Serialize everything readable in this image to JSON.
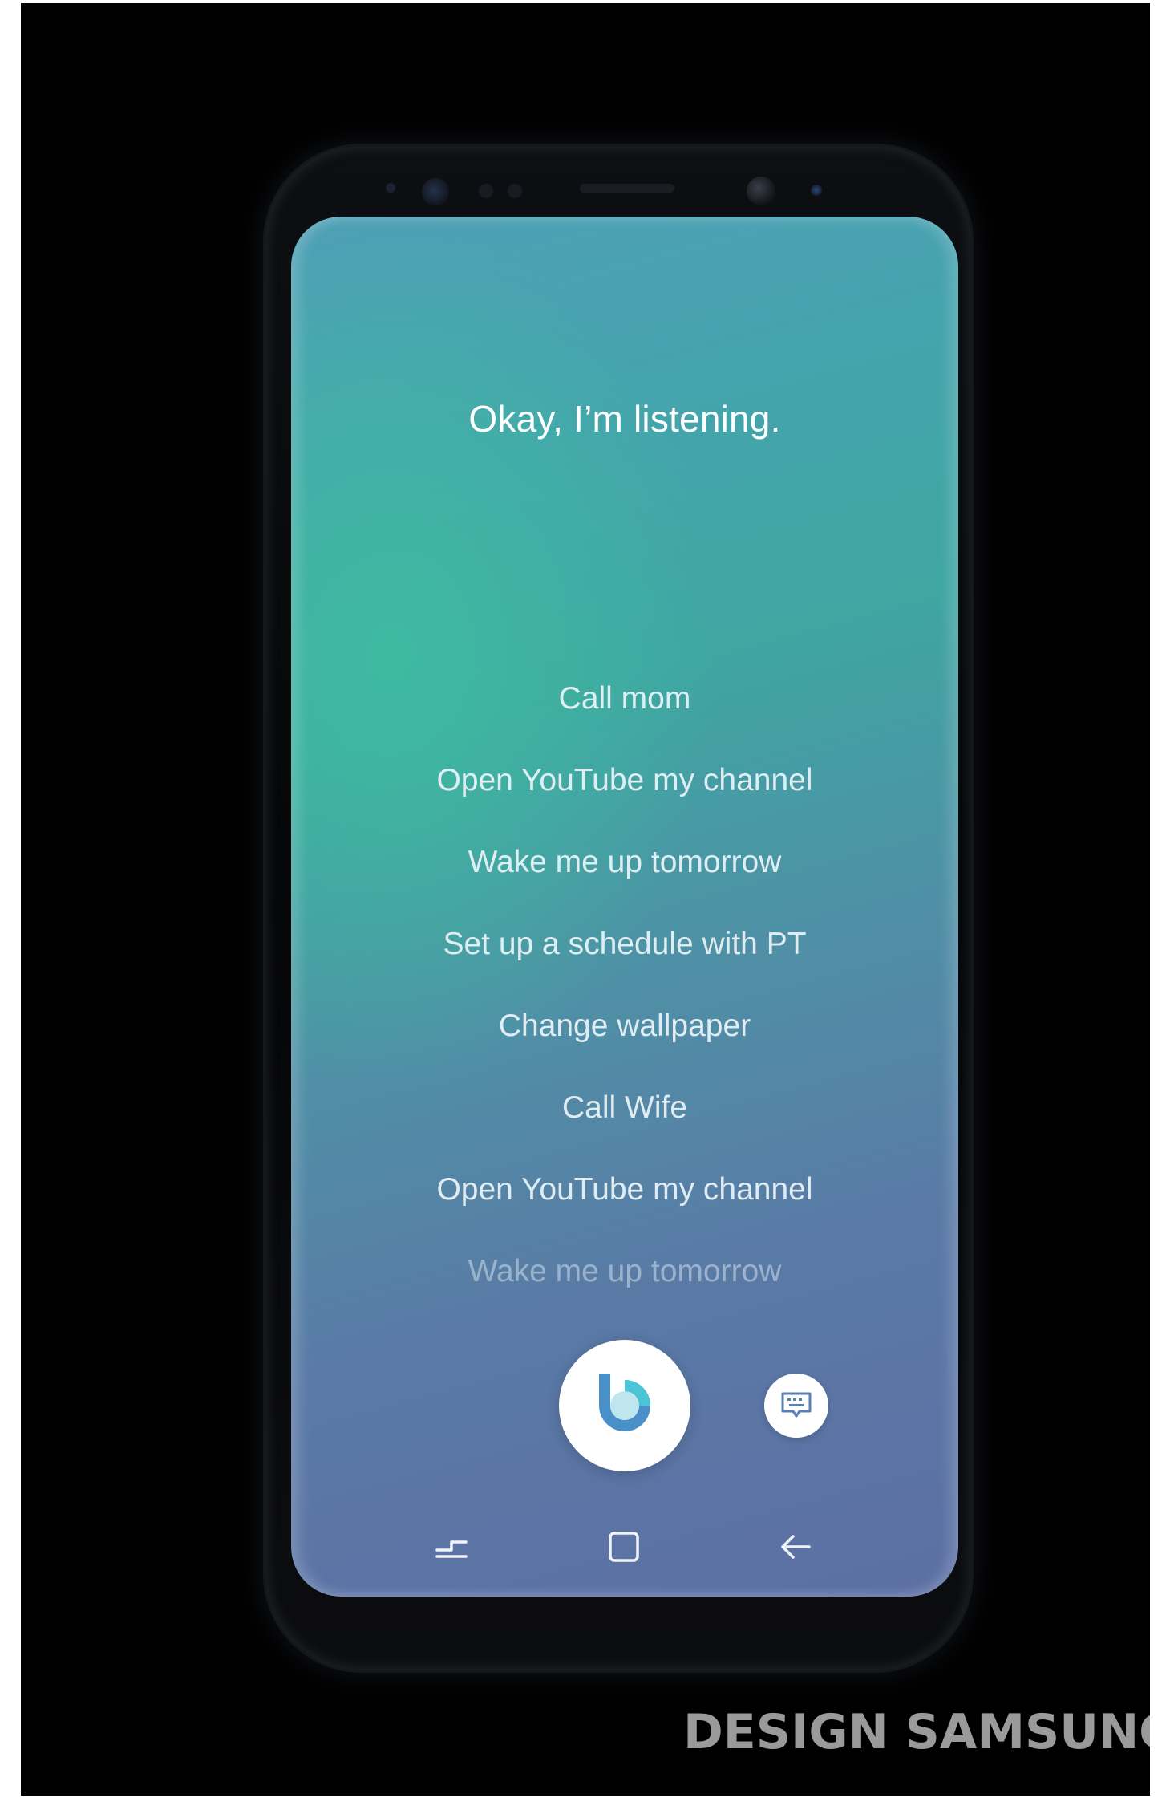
{
  "screen": {
    "title": "Okay, I’m listening.",
    "suggestions": [
      "Call mom",
      "Open YouTube my channel",
      "Wake me up tomorrow",
      "Set up a schedule with PT",
      "Change wallpaper",
      "Call Wife",
      "Open YouTube my channel",
      "Wake me up tomorrow"
    ]
  },
  "controls": {
    "voice_button_icon": "bixby-logo-icon",
    "keyboard_button_icon": "keyboard-icon"
  },
  "nav": {
    "recent_icon": "recent-apps-icon",
    "home_icon": "home-icon",
    "back_icon": "back-arrow-icon"
  },
  "watermark": "DESIGN SAMSUNG",
  "colors": {
    "background": "#000000",
    "screen_top": "#4f9fb6",
    "screen_mid": "#3fa6a2",
    "screen_bottom": "#5c6fa4",
    "bixby_blue": "#4a90c8",
    "bixby_cyan": "#4cc4d8"
  }
}
